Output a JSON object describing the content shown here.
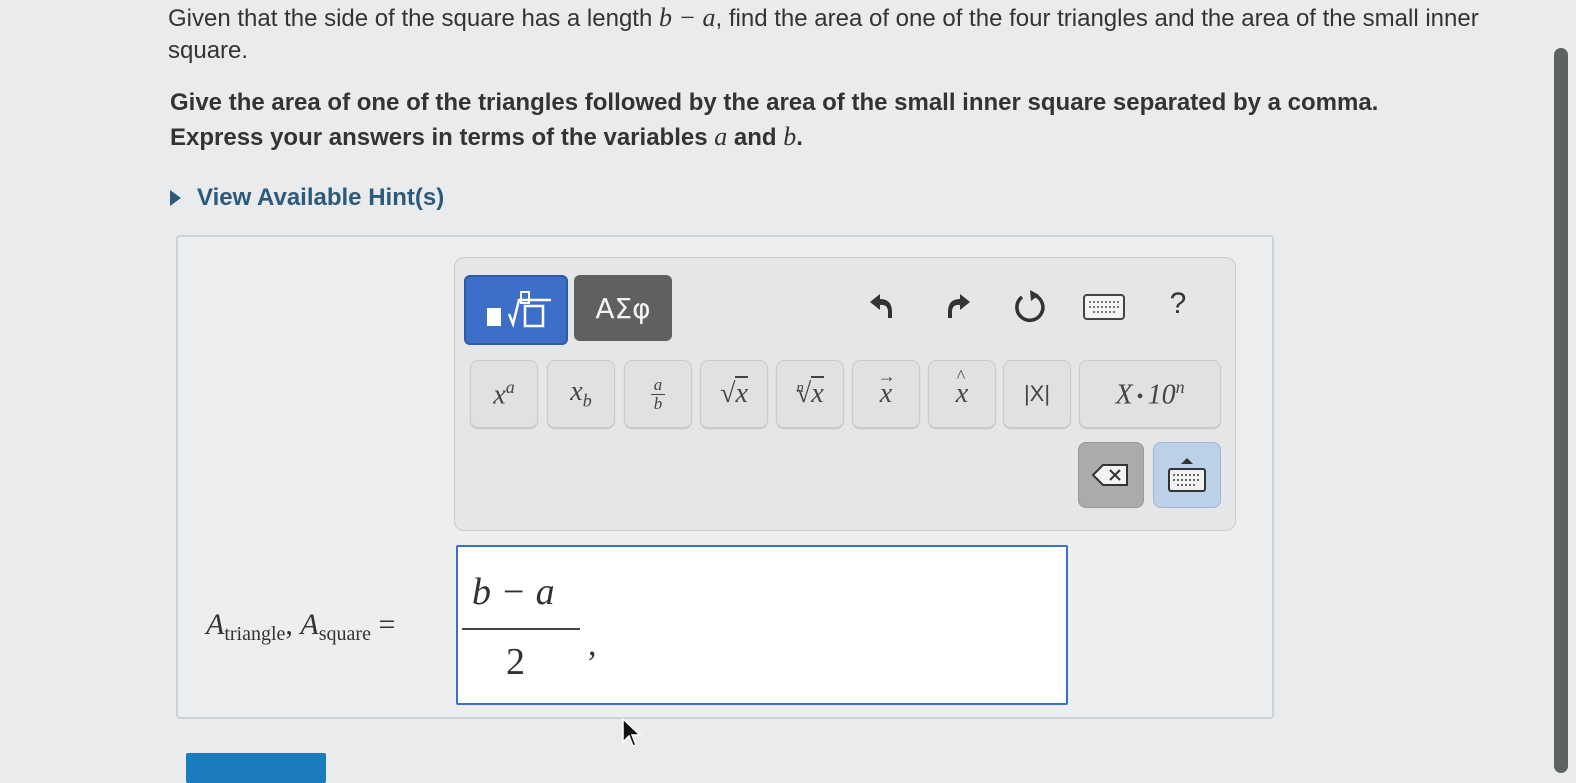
{
  "question": {
    "p1": "Given that the side of the square has a length ",
    "side_expr": "b − a",
    "p2": ", find the area of one of the four triangles and the area of the small inner square."
  },
  "instructions": {
    "line1": "Give the area of one of the triangles followed by the area of the small inner square separated by a comma.",
    "line2_prefix": "Express your answers in terms of the variables ",
    "var_a": "a",
    "and": " and ",
    "var_b": "b",
    "period": "."
  },
  "hint": {
    "label": "View Available Hint(s)"
  },
  "toolbar": {
    "greek_label": "ΑΣφ",
    "help_label": "?",
    "keys": {
      "power": "a",
      "subscript": "b",
      "frac_num": "a",
      "frac_den": "b",
      "sqrt": "x",
      "nth_root_index": "n",
      "nth_root": "x",
      "vector": "x",
      "unit_vector": "x",
      "abs": "|X|",
      "sci_x": "X",
      "sci_dot": "•",
      "sci_ten": "10",
      "sci_n": "n",
      "base_x": "x"
    }
  },
  "answer": {
    "label_A1": "A",
    "label_sub1": "triangle",
    "label_sep": ", ",
    "label_A2": "A",
    "label_sub2": "square",
    "label_eq": " =",
    "fraction_numerator": "b − a",
    "fraction_denominator": "2",
    "trailing": ","
  },
  "colors": {
    "accent": "#3d6fc8",
    "hint": "#2d5a7a",
    "background": "#e9ebec"
  }
}
